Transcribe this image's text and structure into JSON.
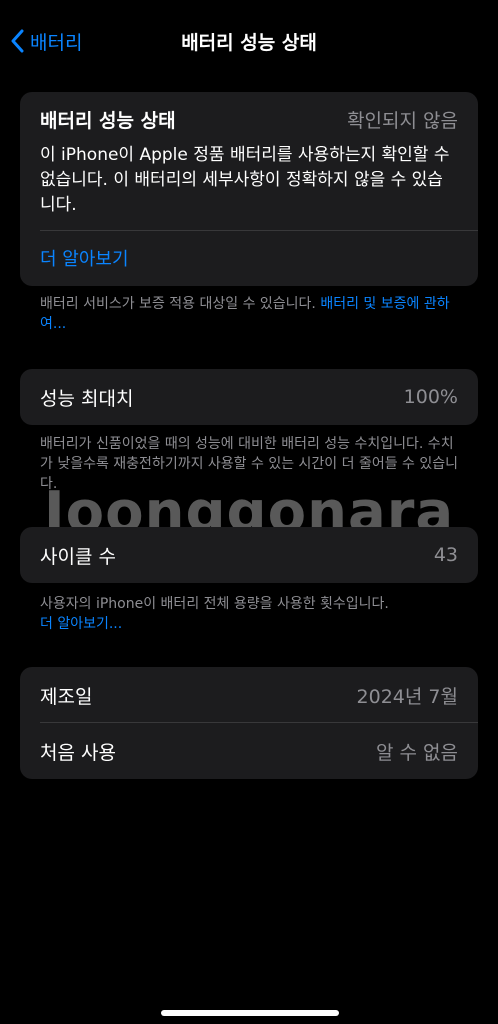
{
  "nav": {
    "back_label": "배터리",
    "title": "배터리 성능 상태"
  },
  "status": {
    "title": "배터리 성능 상태",
    "value": "확인되지 않음",
    "description": "이 iPhone이 Apple 정품 배터리를 사용하는지 확인할 수 없습니다. 이 배터리의 세부사항이 정확하지 않을 수 있습니다.",
    "learn_more": "더 알아보기"
  },
  "service_note": {
    "text": "배터리 서비스가 보증 적용 대상일 수 있습니다. ",
    "link": "배터리 및 보증에 관하여..."
  },
  "max_capacity": {
    "label": "성능 최대치",
    "value": "100%",
    "note": "배터리가 신품이었을 때의 성능에 대비한 배터리 성능 수치입니다. 수치가 낮을수록 재충전하기까지 사용할 수 있는 시간이 더 줄어들 수 있습니다."
  },
  "cycle_count": {
    "label": "사이클 수",
    "value": "43",
    "note": "사용자의 iPhone이 배터리 전체 용량을 사용한 횟수입니다.",
    "learn_more": "더 알아보기..."
  },
  "dates": {
    "manufacture_label": "제조일",
    "manufacture_value": "2024년 7월",
    "first_use_label": "처음 사용",
    "first_use_value": "알 수 없음"
  },
  "watermark": "Joonggonara",
  "colors": {
    "background": "#000000",
    "card": "#1c1c1e",
    "accent": "#0a84ff",
    "secondary": "#8e8e93"
  },
  "icons": {
    "back": "chevron-left-icon"
  }
}
